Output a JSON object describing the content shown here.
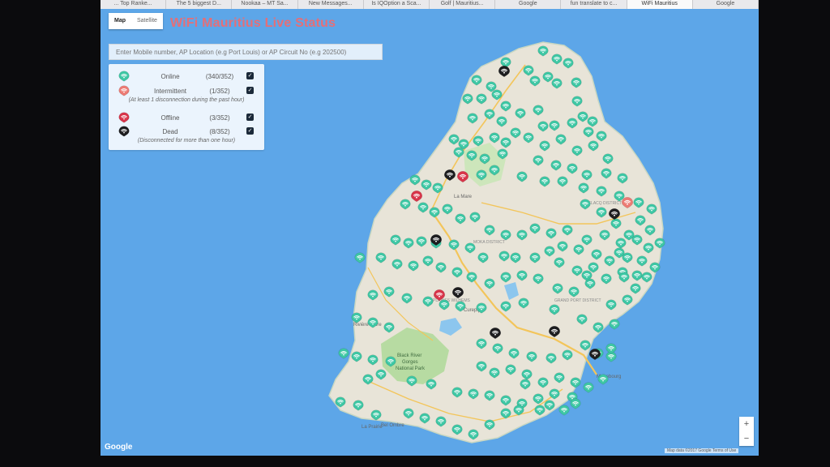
{
  "browser": {
    "tabs": [
      {
        "label": "... Top Ranke...",
        "active": false
      },
      {
        "label": "The 5 biggest D...",
        "active": false
      },
      {
        "label": "Nookaa – MT Sa...",
        "active": false
      },
      {
        "label": "New Messages...",
        "active": false
      },
      {
        "label": "Is IQOption a Sca...",
        "active": false
      },
      {
        "label": "Golf | Mauritius...",
        "active": false
      },
      {
        "label": "Google",
        "active": false
      },
      {
        "label": "fun translate to c...",
        "active": false
      },
      {
        "label": "WiFi Mauritius",
        "active": true
      },
      {
        "label": "Google",
        "active": false
      }
    ]
  },
  "map_type": {
    "map": "Map",
    "satellite": "Satellite"
  },
  "page_title": "WiFi Mauritius Live Status",
  "search": {
    "placeholder": "Enter Mobile number, AP Location (e.g Port Louis) or AP Circuit No (e.g 202500)"
  },
  "legend": {
    "online": {
      "label": "Online",
      "count": "(340/352)",
      "color": "#3ec7a4"
    },
    "intermittent": {
      "label": "Intermittent",
      "count": "(1/352)",
      "color": "#ec7b74"
    },
    "intermittent_note": "(At least 1 disconnection during the past hour)",
    "offline": {
      "label": "Offline",
      "count": "(3/352)",
      "color": "#d8354a"
    },
    "dead": {
      "label": "Dead",
      "count": "(8/352)",
      "color": "#1d1d1f"
    },
    "dead_note": "(Disconnected for more than one hour)"
  },
  "map_labels": {
    "black_river": "Black River",
    "gorges": "Gorges",
    "national_park": "National Park",
    "la_prairie": "La Prairie",
    "bel_ombre": "Bel Ombre",
    "la_mare": "La Mare",
    "grand_port": "GRAND PORT DISTRICT",
    "mahebourg": "Mahebourg",
    "flacq": "FLACQ DISTRICT",
    "riviere_noire": "Rivière Noire",
    "moka": "MOKA DISTRICT",
    "plaines_wilhems": "PLAINES WILHEMS",
    "curepipe": "Curepipe"
  },
  "controls": {
    "zoom_in": "+",
    "zoom_out": "−"
  },
  "footer": {
    "google": "Google",
    "attribution": "Map data ©2017 Google   Terms of Use"
  },
  "icons": {
    "pin": "wifi-pin-icon",
    "check": "check-icon"
  }
}
